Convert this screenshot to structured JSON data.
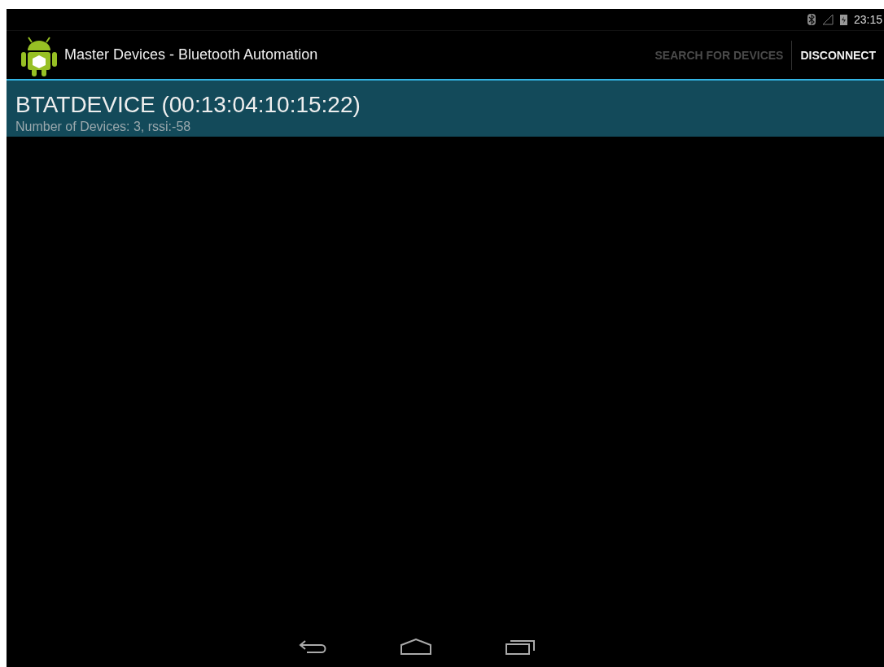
{
  "status_bar": {
    "time": "23:15"
  },
  "action_bar": {
    "title": "Master Devices - Bluetooth Automation",
    "actions": [
      {
        "label": "SEARCH FOR DEVICES",
        "disabled": true
      },
      {
        "label": "DISCONNECT",
        "disabled": false
      }
    ]
  },
  "devices": [
    {
      "name": "BTATDEVICE (00:13:04:10:15:22)",
      "detail": "Number of Devices: 3, rssi:-58",
      "selected": true
    }
  ]
}
